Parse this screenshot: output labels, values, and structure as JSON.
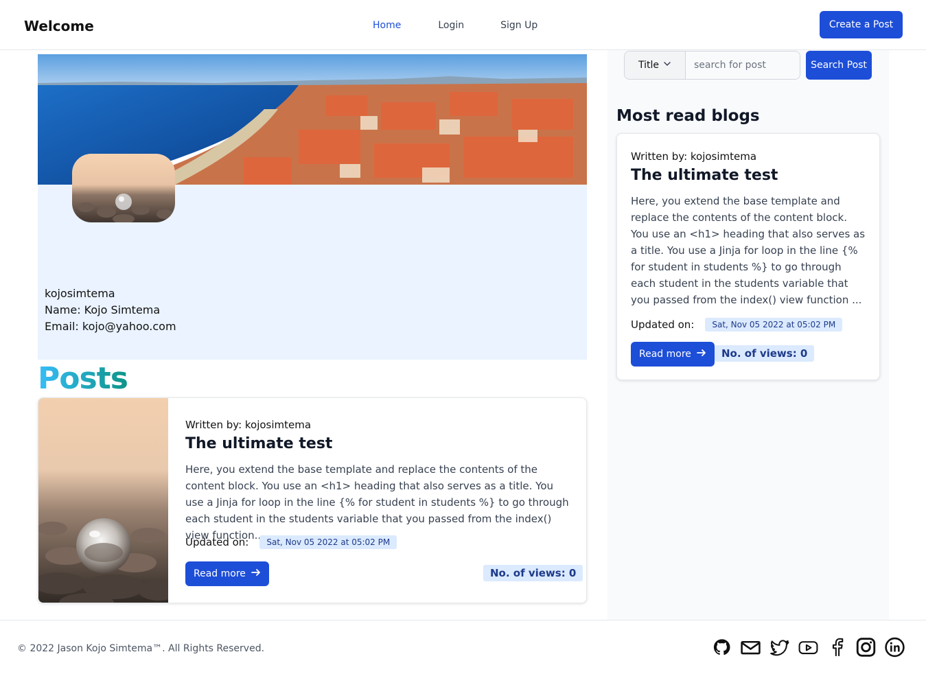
{
  "nav": {
    "brand": "Welcome",
    "links": [
      "Home",
      "Login",
      "Sign Up"
    ],
    "active": "Home",
    "create_button": "Create a Post"
  },
  "profile": {
    "username": "kojosimtema",
    "name_line": "Name: Kojo Simtema",
    "email_line": "Email: kojo@yahoo.com"
  },
  "posts_heading": "Posts",
  "posts": [
    {
      "author": "Written by: kojosimtema",
      "title": "The ultimate test",
      "excerpt": "Here, you extend the base template and replace the contents of the content block. You use an <h1> heading that also serves as a title. You use a Jinja for loop in the line {% for student in students %} to go through each student in the students variable that you passed from the index() view function...",
      "updated_label": "Updated on:",
      "updated_date": "Sat, Nov 05 2022 at 05:02 PM",
      "read_more": "Read more",
      "views": "No. of views: 0"
    }
  ],
  "search": {
    "select_value": "Title",
    "placeholder": "search for post",
    "button": "Search Post"
  },
  "sidebar": {
    "heading": "Most read blogs",
    "card": {
      "author": "Written by: kojosimtema",
      "title": "The ultimate test",
      "excerpt": "Here, you extend the base template and replace the contents of the content block. You use an <h1> heading that also serves as a title. You use a Jinja for loop in the line {% for student in students %} to go through each student in the students variable that you passed from the index() view function ...",
      "updated_label": "Updated on:",
      "updated_date": "Sat, Nov 05 2022 at 05:02 PM",
      "read_more": "Read more",
      "views": "No. of views: 0"
    }
  },
  "footer": {
    "copyright": "© 2022 Jason Kojo Simtema™. All Rights Reserved.",
    "social_icons": [
      "github-icon",
      "mail-icon",
      "twitter-icon",
      "youtube-icon",
      "facebook-icon",
      "instagram-icon",
      "linkedin-icon"
    ]
  },
  "colors": {
    "primary": "#1d4ed8",
    "badge_bg": "#dbeafe",
    "profile_bg": "#eaf3ff",
    "posts_gradient_start": "#38bdf8",
    "posts_gradient_end": "#0d9488"
  }
}
